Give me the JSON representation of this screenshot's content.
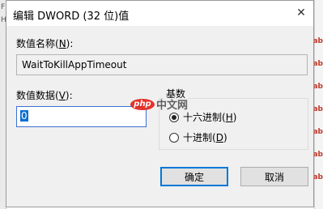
{
  "window": {
    "title": "编辑 DWORD (32 位)值",
    "close_glyph": "✕"
  },
  "value_name": {
    "label_prefix": "数值名称(",
    "label_hotkey": "N",
    "label_suffix": "):",
    "value": "WaitToKillAppTimeout"
  },
  "value_data": {
    "label_prefix": "数值数据(",
    "label_hotkey": "V",
    "label_suffix": "):",
    "value": "0"
  },
  "base": {
    "label": "基数",
    "options": [
      {
        "label_prefix": "十六进制(",
        "hotkey": "H",
        "label_suffix": ")",
        "checked": true
      },
      {
        "label_prefix": "十进制(",
        "hotkey": "D",
        "label_suffix": ")",
        "checked": false
      }
    ]
  },
  "buttons": {
    "ok": "确定",
    "cancel": "取消"
  },
  "watermark": {
    "logo": "php",
    "text": "中文网"
  },
  "background": {
    "left_marks": [
      "F",
      "H"
    ],
    "right_marks": [
      "ab",
      "ab",
      "ab",
      "ab",
      "ab",
      "ab",
      "ab"
    ]
  }
}
